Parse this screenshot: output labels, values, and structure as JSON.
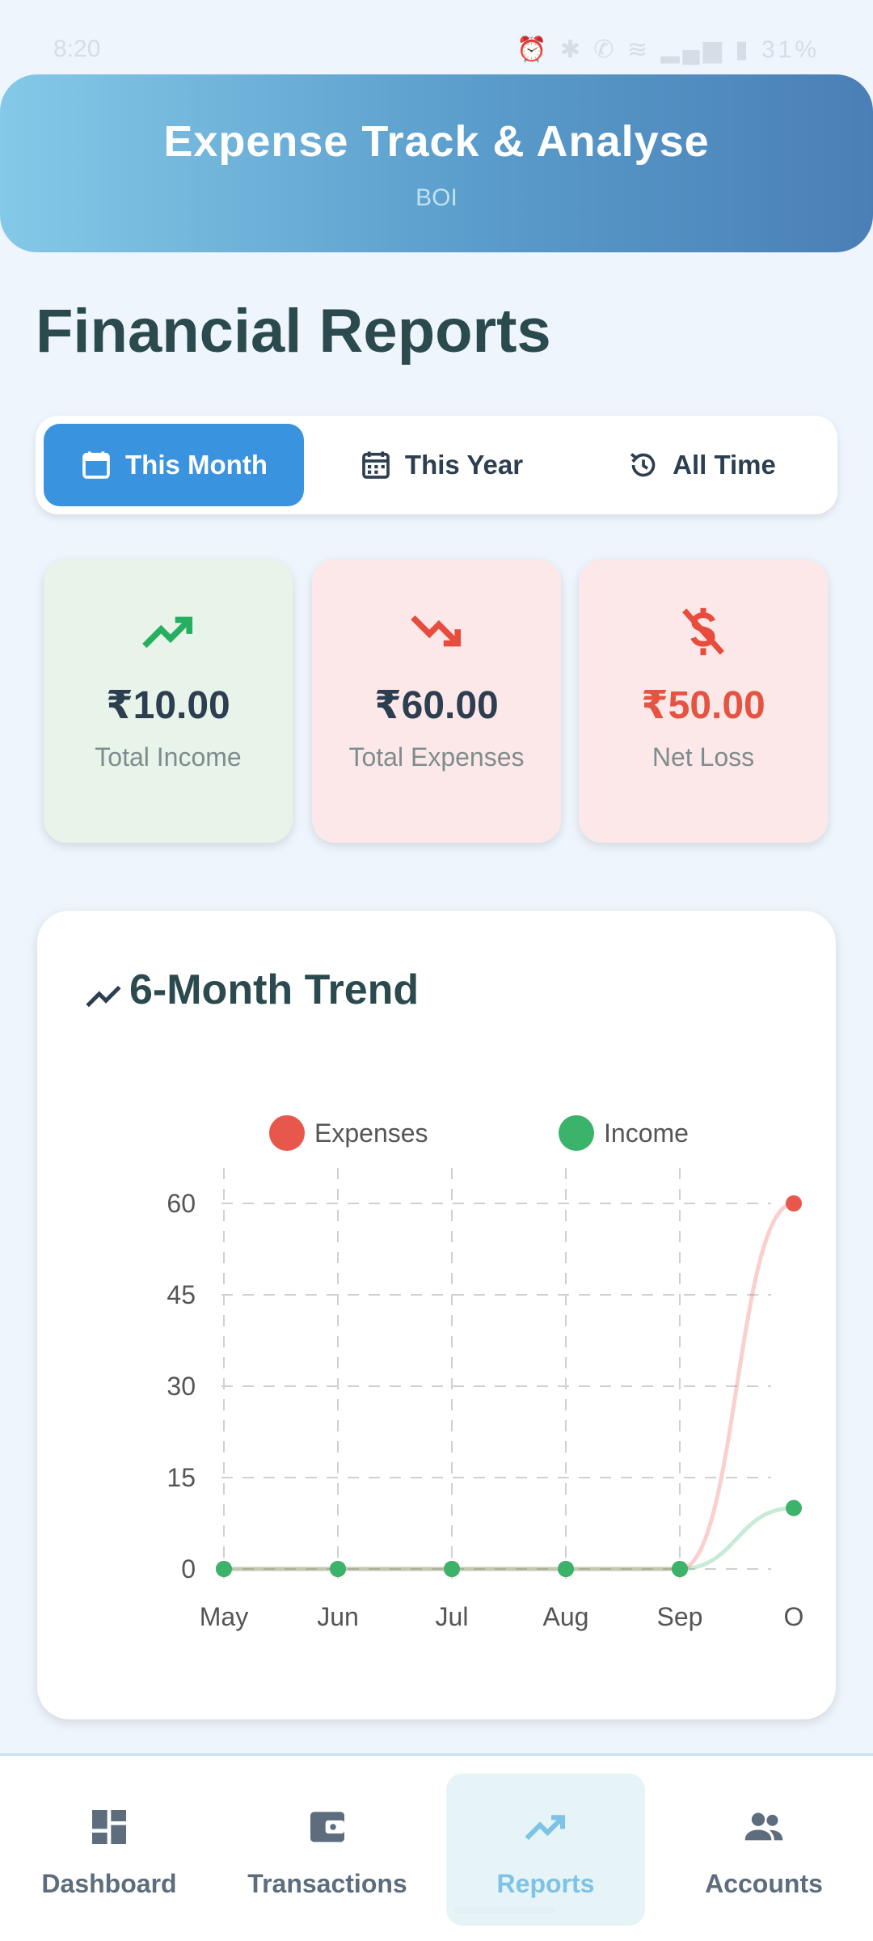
{
  "status_bar": {
    "time": "8:20",
    "battery": "31%"
  },
  "header": {
    "title": "Expense Track & Analyse",
    "subtitle": "BOI"
  },
  "page": {
    "title": "Financial Reports"
  },
  "period_tabs": [
    {
      "label": "This Month",
      "icon": "calendar-icon",
      "active": true
    },
    {
      "label": "This Year",
      "icon": "calendar-grid-icon",
      "active": false
    },
    {
      "label": "All Time",
      "icon": "history-icon",
      "active": false
    }
  ],
  "summary": {
    "income": {
      "value": "₹10.00",
      "label": "Total Income",
      "icon": "trending-up-icon",
      "color": "#27ae60"
    },
    "expenses": {
      "value": "₹60.00",
      "label": "Total Expenses",
      "icon": "trending-down-icon",
      "color": "#e74c3c"
    },
    "net": {
      "value": "₹50.00",
      "label": "Net Loss",
      "icon": "money-off-icon",
      "color": "#e74c3c"
    }
  },
  "trend": {
    "title": "6-Month Trend",
    "icon": "trend-line-icon"
  },
  "chart_data": {
    "type": "line",
    "title": "6-Month Trend",
    "categories": [
      "May",
      "Jun",
      "Jul",
      "Aug",
      "Sep",
      "Oct"
    ],
    "category_labels_shown": [
      "May",
      "Jun",
      "Jul",
      "Aug",
      "Sep",
      "O"
    ],
    "series": [
      {
        "name": "Expenses",
        "color": "#e8574c",
        "values": [
          0,
          0,
          0,
          0,
          0,
          60
        ]
      },
      {
        "name": "Income",
        "color": "#3bb36a",
        "values": [
          0,
          0,
          0,
          0,
          0,
          10
        ]
      }
    ],
    "ylim": [
      0,
      60
    ],
    "yticks": [
      0,
      15,
      30,
      45,
      60
    ],
    "grid": true,
    "legend": "top"
  },
  "nav": [
    {
      "label": "Dashboard",
      "icon": "dashboard-icon",
      "active": false
    },
    {
      "label": "Transactions",
      "icon": "wallet-icon",
      "active": false
    },
    {
      "label": "Reports",
      "icon": "trending-up-icon",
      "active": true
    },
    {
      "label": "Accounts",
      "icon": "people-icon",
      "active": false
    }
  ]
}
